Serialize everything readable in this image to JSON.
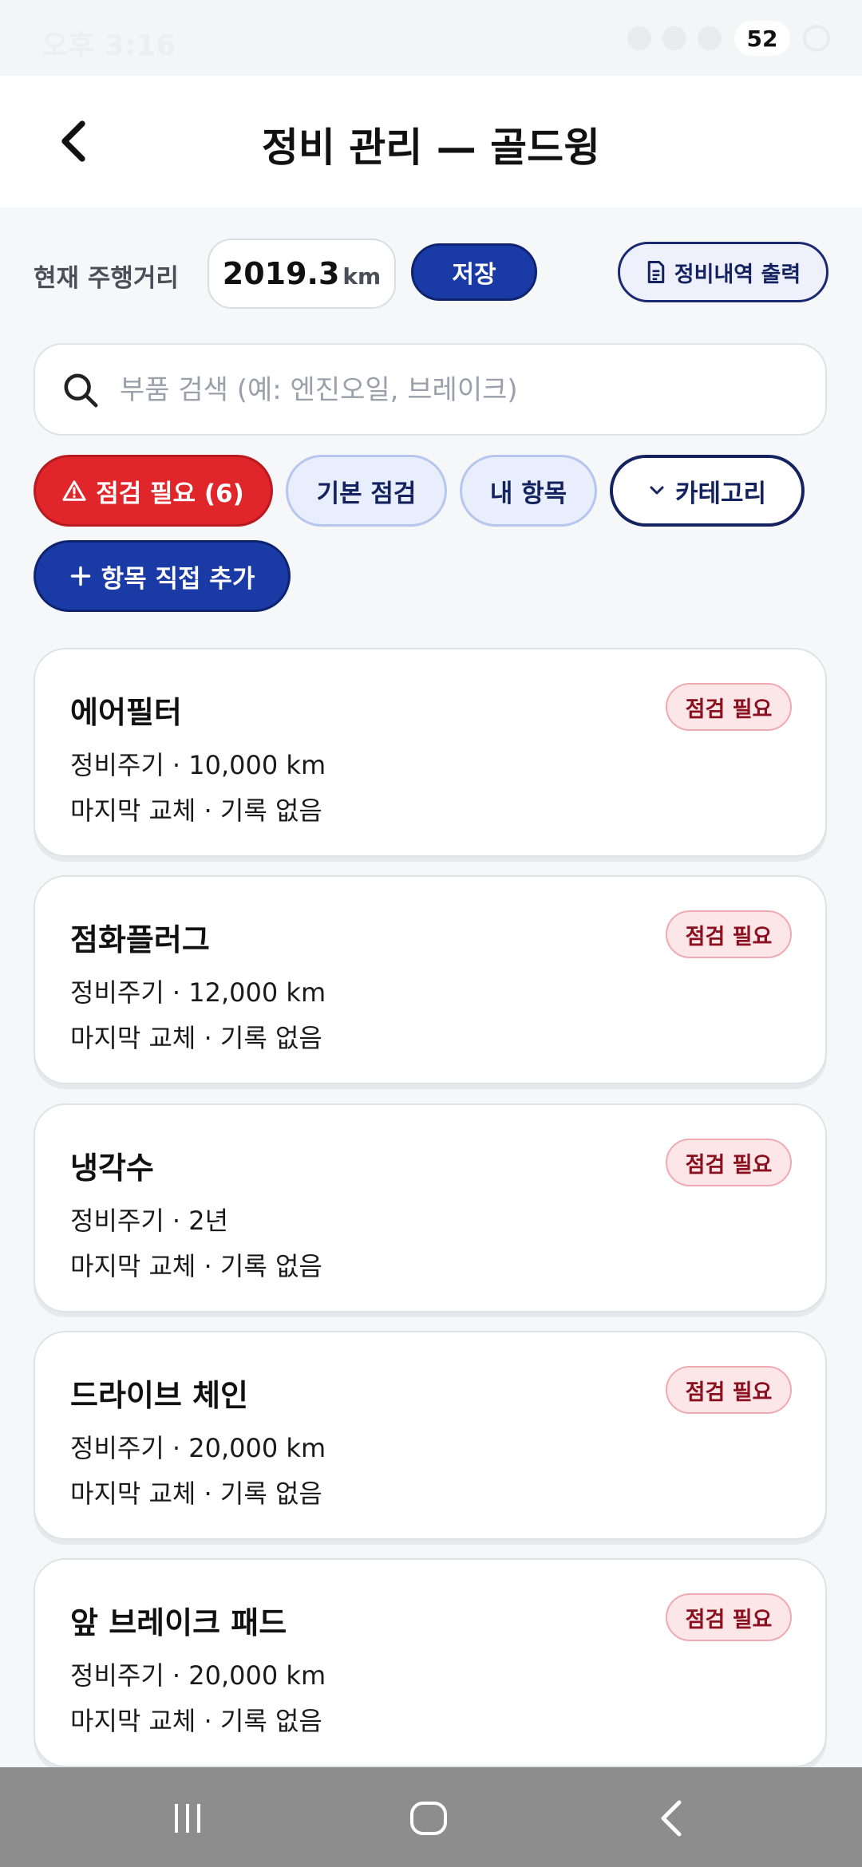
{
  "status_bar": {
    "time": "오후 3:16",
    "battery": "52"
  },
  "app_bar": {
    "title": "정비 관리 — 골드윙"
  },
  "odometer": {
    "label": "현재 주행거리",
    "value": "2019.3",
    "unit": "km",
    "save_label": "저장",
    "print_label": "정비내역 출력"
  },
  "search": {
    "placeholder": "부품 검색 (예: 엔진오일, 브레이크)",
    "value": ""
  },
  "filters": {
    "needs_check": "점검 필요 (6)",
    "basic": "기본 점검",
    "mine": "내 항목",
    "category": "카테고리",
    "add": "항목 직접 추가"
  },
  "items": [
    {
      "name": "에어필터",
      "cycle": "정비주기 · 10,000 km",
      "last": "마지막 교체 · 기록 없음",
      "badge": "점검 필요"
    },
    {
      "name": "점화플러그",
      "cycle": "정비주기 · 12,000 km",
      "last": "마지막 교체 · 기록 없음",
      "badge": "점검 필요"
    },
    {
      "name": "냉각수",
      "cycle": "정비주기 · 2년",
      "last": "마지막 교체 · 기록 없음",
      "badge": "점검 필요"
    },
    {
      "name": "드라이브 체인",
      "cycle": "정비주기 · 20,000 km",
      "last": "마지막 교체 · 기록 없음",
      "badge": "점검 필요"
    },
    {
      "name": "앞 브레이크 패드",
      "cycle": "정비주기 · 20,000 km",
      "last": "마지막 교체 · 기록 없음",
      "badge": "점검 필요"
    }
  ],
  "colors": {
    "primary": "#1a3aa6",
    "alert": "#e0262b",
    "badge_bg": "#fde6e8",
    "badge_text": "#8a1020"
  },
  "icons": {
    "back": "chevron-left-icon",
    "print": "document-icon",
    "search": "search-icon",
    "warning": "warning-icon",
    "dropdown": "chevron-down-icon",
    "add": "plus-icon"
  }
}
